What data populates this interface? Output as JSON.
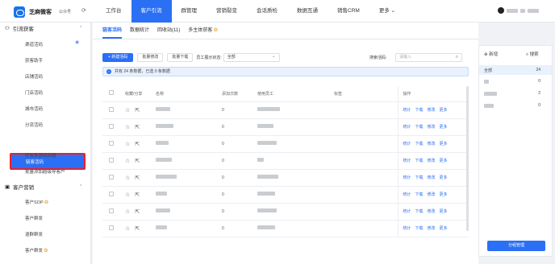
{
  "header": {
    "brand": "芝麻微客",
    "org": "公众号",
    "nav": [
      "工作台",
      "客户引流",
      "群管理",
      "营销裂变",
      "会话质检",
      "数据互通",
      "销售CRM",
      "更多 ⌄"
    ],
    "active_nav": "客户引流"
  },
  "sidebar": {
    "section1": "引流获客",
    "section1_items": [
      "渠道活码",
      "获客助手",
      "店铺活码",
      "门店活码",
      "城市活码",
      "分流活码",
      "链客活码",
      "好友来源收回器",
      "批量添加超级导客户"
    ],
    "section2": "客户营销",
    "section2_items": [
      "客户SOP",
      "客户群发",
      "退群群发",
      "客户群发"
    ]
  },
  "tabs": [
    "链客活码",
    "数据统计",
    "回收站(11)",
    "多主体获客"
  ],
  "toolbar": {
    "new_label": "+ 新建活码",
    "batch_edit": "批量修改",
    "batch_download": "批量下载",
    "filter_label": "员工展示状态:",
    "filter_value": "全部",
    "search_label": "搜索活码:",
    "search_placeholder": "请输入"
  },
  "info": "共有 24 条数据，已选 0 条数据",
  "table": {
    "headers": [
      "",
      "收藏/分享",
      "名称",
      "添加次数",
      "使用员工",
      "标签",
      "操作"
    ],
    "rows": [
      {
        "count": "0"
      },
      {
        "count": "0"
      },
      {
        "count": "0"
      },
      {
        "count": "0"
      },
      {
        "count": "0"
      },
      {
        "count": "0"
      },
      {
        "count": "0"
      },
      {
        "count": "0"
      }
    ],
    "ops": [
      "统计",
      "下载",
      "修改",
      "更多"
    ]
  },
  "rpanel": {
    "add": "新增",
    "search": "搜索",
    "groups": [
      {
        "label": "全部",
        "count": "24"
      },
      {
        "label": "",
        "count": "0"
      },
      {
        "label": "",
        "count": "2"
      },
      {
        "label": "",
        "count": "0"
      }
    ],
    "button": "分组管理"
  }
}
